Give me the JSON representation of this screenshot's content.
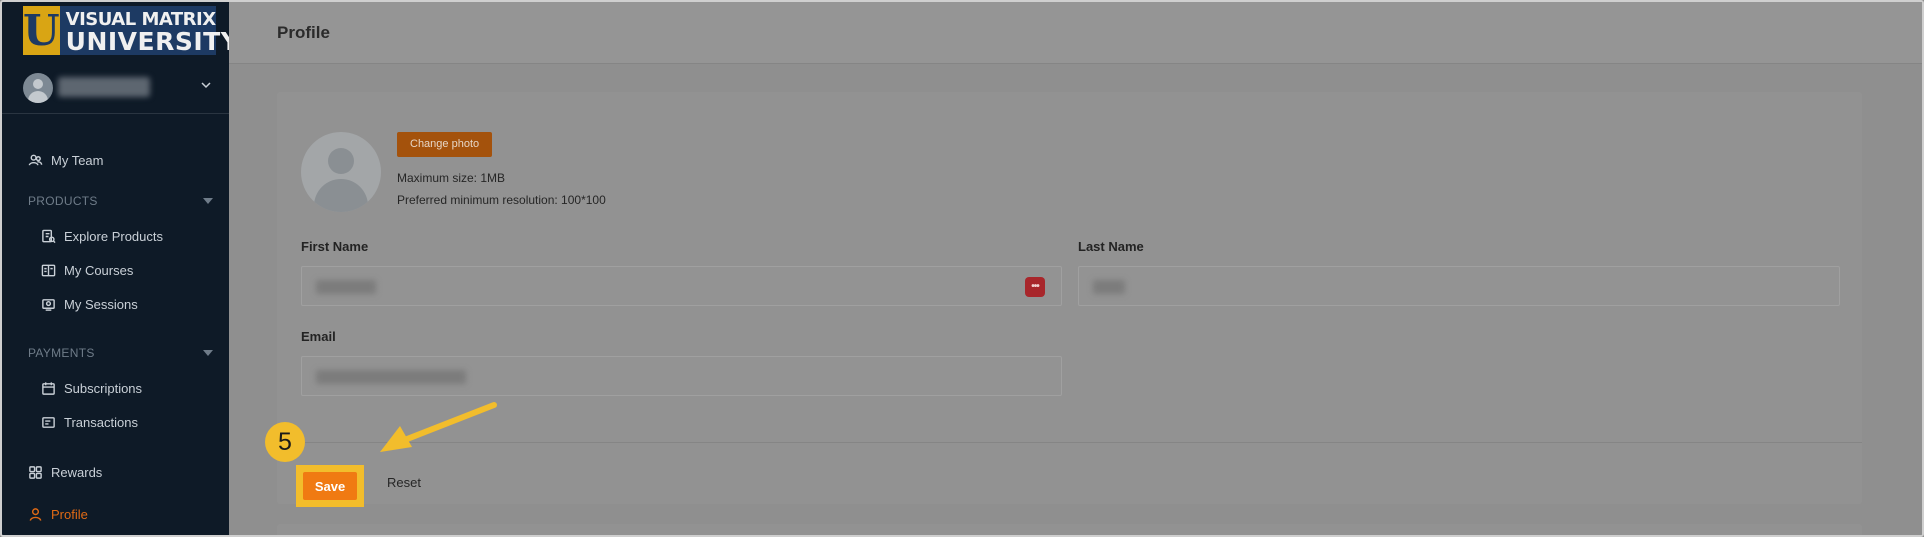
{
  "logo": {
    "mark": "U",
    "line1": "VISUAL MATRIX",
    "line2": "UNIVERSITY"
  },
  "sidebar": {
    "items": [
      {
        "label": "My Team",
        "icon": "team-icon"
      },
      {
        "section": "PRODUCTS"
      },
      {
        "label": "Explore Products",
        "icon": "explore-products-icon"
      },
      {
        "label": "My Courses",
        "icon": "courses-icon"
      },
      {
        "label": "My Sessions",
        "icon": "sessions-icon"
      },
      {
        "section": "PAYMENTS"
      },
      {
        "label": "Subscriptions",
        "icon": "calendar-icon"
      },
      {
        "label": "Transactions",
        "icon": "receipt-icon"
      },
      {
        "label": "Rewards",
        "icon": "grid-icon"
      },
      {
        "label": "Profile",
        "icon": "user-icon",
        "active": true
      }
    ]
  },
  "header": {
    "title": "Profile"
  },
  "photo": {
    "change_label": "Change photo",
    "max_size": "Maximum size: 1MB",
    "resolution": "Preferred minimum resolution: 100*100"
  },
  "form": {
    "first_name_label": "First Name",
    "last_name_label": "Last Name",
    "email_label": "Email"
  },
  "actions": {
    "save_label": "Save",
    "reset_label": "Reset"
  },
  "annotation": {
    "step": "5"
  },
  "colors": {
    "accent": "#f07a12",
    "highlight": "#f2bd2c",
    "sidebar_bg": "#0e1a27",
    "active_nav": "#e06a15"
  }
}
